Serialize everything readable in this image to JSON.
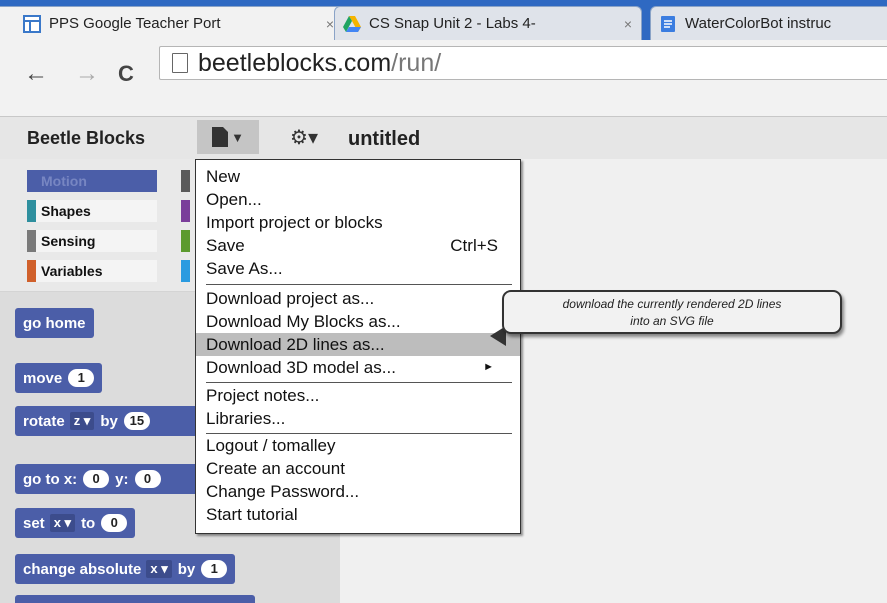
{
  "browser": {
    "tabs": [
      {
        "title": "PPS Google Teacher Port",
        "icon": "google-sites-icon"
      },
      {
        "title": "CS Snap Unit 2 - Labs 4-",
        "icon": "google-drive-icon"
      },
      {
        "title": "WaterColorBot instruc",
        "icon": "google-docs-icon"
      }
    ],
    "close_glyph": "×",
    "back_glyph": "←",
    "forward_glyph": "→",
    "reload_glyph": "C",
    "url_host": "beetleblocks.com",
    "url_path": "/run/"
  },
  "app": {
    "title": "Beetle Blocks",
    "project_name": "untitled",
    "project_button_glyph": "▼",
    "settings_button_glyph": "⚙▾"
  },
  "categories": [
    {
      "label": "Motion",
      "color": "#4b5ea8"
    },
    {
      "label": "Shapes",
      "color": "#2e8f9e"
    },
    {
      "label": "Sensing",
      "color": "#7a7a7a"
    },
    {
      "label": "Variables",
      "color": "#d0602b"
    }
  ],
  "blocks": {
    "go_home": "go home",
    "move": {
      "label": "move",
      "value": "1"
    },
    "rotate": {
      "label": "rotate",
      "axis": "z",
      "by": "by",
      "value": "15"
    },
    "goto": {
      "label": "go to x:",
      "x": "0",
      "ylabel": "y:",
      "y": "0"
    },
    "set": {
      "label": "set",
      "var": "x",
      "to": "to",
      "value": "0"
    },
    "change_absolute": {
      "label": "change absolute",
      "var": "x",
      "by": "by",
      "value": "1"
    }
  },
  "menu": {
    "items": [
      {
        "label": "New"
      },
      {
        "label": "Open..."
      },
      {
        "label": "Import project or blocks"
      },
      {
        "label": "Save",
        "shortcut": "Ctrl+S"
      },
      {
        "label": "Save As..."
      },
      {
        "label": "Download project as..."
      },
      {
        "label": "Download My Blocks as..."
      },
      {
        "label": "Download 2D lines as...",
        "highlighted": true
      },
      {
        "label": "Download 3D model as...",
        "submenu": "►"
      },
      {
        "label": "Project notes..."
      },
      {
        "label": "Libraries..."
      },
      {
        "label": "Logout / tomalley"
      },
      {
        "label": "Create an account"
      },
      {
        "label": "Change Password..."
      },
      {
        "label": "Start tutorial"
      }
    ]
  },
  "tooltip": {
    "line1": "download the currently rendered 2D lines",
    "line2": "into an SVG file"
  },
  "colors": {
    "tabstrip": "#2f69c2",
    "block_motion": "#4b5ea8",
    "menu_highlight": "#bdbdbd"
  }
}
